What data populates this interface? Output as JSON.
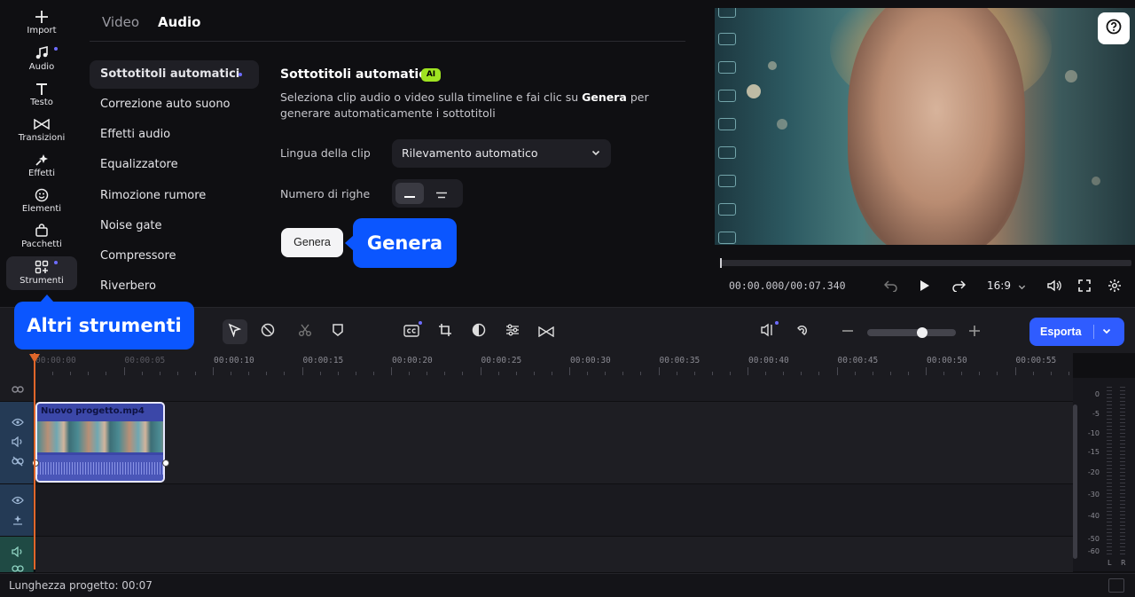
{
  "rail": {
    "items": [
      {
        "label": "Import",
        "icon": "plus-icon"
      },
      {
        "label": "Audio",
        "icon": "music-note-icon"
      },
      {
        "label": "Testo",
        "icon": "text-icon"
      },
      {
        "label": "Transizioni",
        "icon": "transitions-icon"
      },
      {
        "label": "Effetti",
        "icon": "sparkle-icon"
      },
      {
        "label": "Elementi",
        "icon": "smiley-icon"
      },
      {
        "label": "Pacchetti",
        "icon": "bag-icon"
      },
      {
        "label": "Strumenti",
        "icon": "tools-grid-icon"
      }
    ]
  },
  "panel": {
    "tabs": [
      "Video",
      "Audio"
    ],
    "active_tab": "Audio",
    "subnav": [
      "Sottotitoli automatici",
      "Correzione auto suono",
      "Effetti audio",
      "Equalizzatore",
      "Rimozione rumore",
      "Noise gate",
      "Compressore",
      "Riverbero"
    ],
    "section_title": "Sottotitoli automatici",
    "ai_badge": "AI",
    "description_before": "Seleziona clip audio o video sulla timeline e fai clic su ",
    "description_bold": "Genera",
    "description_after": " per generare automaticamente i sottotitoli",
    "language_label": "Lingua della clip",
    "language_value": "Rilevamento automatico",
    "rows_label": "Numero di righe",
    "generate_button": "Genera"
  },
  "callouts": {
    "genera": "Genera",
    "altri_strumenti": "Altri strumenti"
  },
  "preview": {
    "timecode": "00:00.000/00:07.340",
    "aspect_ratio": "16:9"
  },
  "toolbar": {
    "export_label": "Esporta"
  },
  "timeline": {
    "ruler": [
      "00:00:00",
      "00:00:05",
      "00:00:10",
      "00:00:15",
      "00:00:20",
      "00:00:25",
      "00:00:30",
      "00:00:35",
      "00:00:40",
      "00:00:45",
      "00:00:50",
      "00:00:55"
    ],
    "clip_title": "Nuovo progetto.mp4"
  },
  "meter": {
    "scale": [
      "0",
      "-5",
      "-10",
      "-15",
      "-20",
      "-30",
      "-40",
      "-50",
      "-60"
    ],
    "channels": [
      "L",
      "R"
    ]
  },
  "status": {
    "project_length": "Lunghezza progetto: 00:07"
  },
  "colors": {
    "accent": "#0b56ff",
    "export": "#2f5cff",
    "ai_badge": "#9fe321",
    "playhead": "#e0662a",
    "clip": "#3b47a8"
  }
}
